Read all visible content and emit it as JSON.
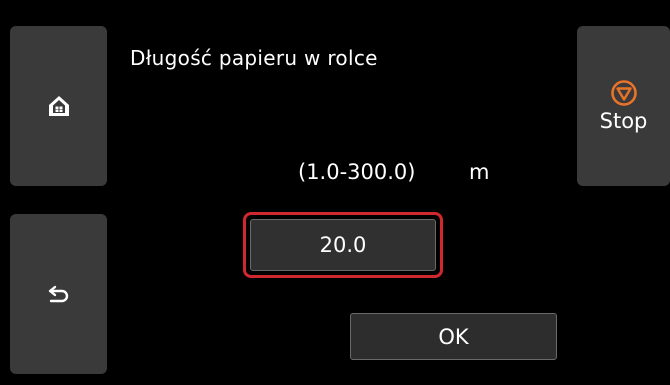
{
  "title": "Długość papieru w rolce",
  "range_text": "(1.0-300.0)",
  "unit": "m",
  "value_input": {
    "value": "20.0"
  },
  "ok_label": "OK",
  "stop_label": "Stop",
  "icons": {
    "home": "home-icon",
    "back": "back-arrow-icon",
    "stop": "stop-icon"
  },
  "colors": {
    "background": "#000000",
    "button": "#3a3a3a",
    "focus_border": "#d0282e",
    "stop_icon": "#e8742a"
  }
}
